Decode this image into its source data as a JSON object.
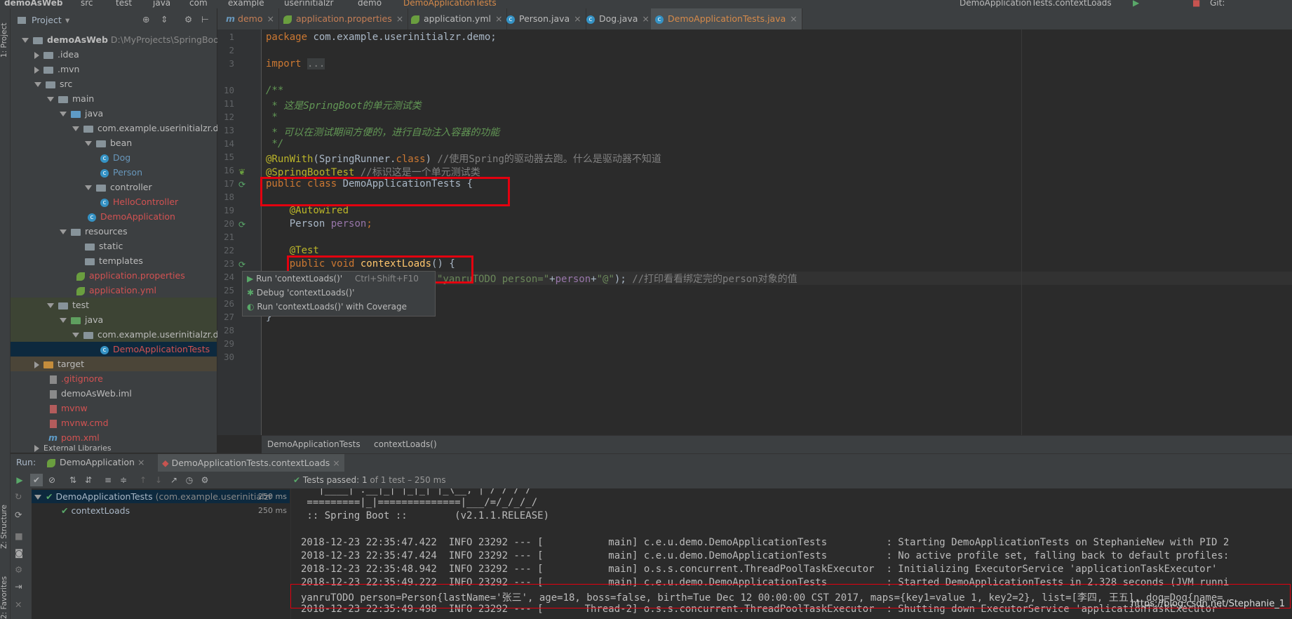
{
  "navbar": {
    "crumbs": [
      "demoAsWeb",
      "src",
      "test",
      "java",
      "com",
      "example",
      "userinitialzr",
      "demo",
      "DemoApplicationTests"
    ],
    "run_config": "DemoApplicationTests.contextLoads",
    "git_label": "Git:"
  },
  "left_stripe": {
    "project_label": "1: Project",
    "structure_label": "Z: Structure",
    "favorites_label": "2: Favorites"
  },
  "project_panel": {
    "title": "Project",
    "tree": [
      {
        "label": "demoAsWeb",
        "extra": "D:\\MyProjects\\SpringBootStu"
      },
      {
        "label": ".idea"
      },
      {
        "label": ".mvn"
      },
      {
        "label": "src"
      },
      {
        "label": "main"
      },
      {
        "label": "java"
      },
      {
        "label": "com.example.userinitialzr.demo"
      },
      {
        "label": "bean"
      },
      {
        "label": "Dog"
      },
      {
        "label": "Person"
      },
      {
        "label": "controller"
      },
      {
        "label": "HelloController"
      },
      {
        "label": "DemoApplication"
      },
      {
        "label": "resources"
      },
      {
        "label": "static"
      },
      {
        "label": "templates"
      },
      {
        "label": "application.properties"
      },
      {
        "label": "application.yml"
      },
      {
        "label": "test"
      },
      {
        "label": "java"
      },
      {
        "label": "com.example.userinitialzr.demo"
      },
      {
        "label": "DemoApplicationTests"
      },
      {
        "label": "target"
      },
      {
        "label": ".gitignore"
      },
      {
        "label": "demoAsWeb.iml"
      },
      {
        "label": "mvnw"
      },
      {
        "label": "mvnw.cmd"
      },
      {
        "label": "pom.xml"
      },
      {
        "label": "External Libraries"
      }
    ]
  },
  "editor_tabs": [
    "demo",
    "application.properties",
    "application.yml",
    "Person.java",
    "Dog.java",
    "DemoApplicationTests.java"
  ],
  "editor": {
    "line_numbers": [
      "1",
      "2",
      "3",
      "10",
      "11",
      "12",
      "13",
      "14",
      "15",
      "16",
      "17",
      "18",
      "19",
      "20",
      "21",
      "22",
      "23",
      "24",
      "25",
      "26",
      "27",
      "28",
      "29",
      "30"
    ],
    "lines": {
      "l1_kw": "package ",
      "l1_rest": "com.example.userinitialzr.demo;",
      "l3_kw": "import ",
      "l3_rest": "...",
      "l10": "/**",
      "l11_a": " * 这是",
      "l11_b": "SpringBoot",
      "l11_c": "的单元测试类",
      "l12": " *",
      "l13": " * 可以在测试期间方便的，进行自动注入容器的功能",
      "l14": " */",
      "l15_an": "@RunWith",
      "l15_a": "(SpringRunner.",
      "l15_kw": "class",
      "l15_b": ") ",
      "l15_cm": "//使用Spring的驱动器去跑。什么是驱动器不知道",
      "l16_an": "@SpringBootTest ",
      "l16_cm": "//标识这是一个单元测试类",
      "l17_kw": "public class ",
      "l17_rest": "DemoApplicationTests {",
      "l19_an": "@Autowired",
      "l20_a": "Person ",
      "l20_b": "person",
      "l20_c": ";",
      "l22_an": "@Test",
      "l23_kw": "public void ",
      "l23_fn": "contextLoads",
      "l23_rest": "() {",
      "l24_str": "\"yanruTODO person=\"",
      "l24_a": "+",
      "l24_b": "person",
      "l24_c": "+",
      "l24_str2": "\"@\"",
      "l24_d": "); ",
      "l24_cm": "//打印看看绑定完的person对象的值",
      "l28": "}"
    },
    "popup": {
      "run": "Run 'contextLoads()'",
      "shortcut": "Ctrl+Shift+F10",
      "debug": "Debug 'contextLoads()'",
      "coverage": "Run 'contextLoads()' with Coverage"
    },
    "breadcrumb": [
      "DemoApplicationTests",
      "contextLoads()"
    ]
  },
  "run_panel": {
    "run_label": "Run:",
    "tabs": [
      "DemoApplication",
      "DemoApplicationTests.contextLoads"
    ],
    "status_prefix": "Tests passed:",
    "status_count": "1",
    "status_suffix": "of 1 test – 250 ms",
    "tree": [
      {
        "label": "DemoApplicationTests",
        "extra": "(com.example.userinitialzr",
        "time": "250 ms"
      },
      {
        "label": "contextLoads",
        "time": "250 ms"
      }
    ],
    "console": [
      "   |____| .__|_| |_|_| |_\\__, | / / / /",
      " =========|_|==============|___/=/_/_/_/",
      " :: Spring Boot ::        (v2.1.1.RELEASE)",
      "",
      "2018-12-23 22:35:47.422  INFO 23292 --- [           main] c.e.u.demo.DemoApplicationTests          : Starting DemoApplicationTests on StephanieNew with PID 2",
      "2018-12-23 22:35:47.424  INFO 23292 --- [           main] c.e.u.demo.DemoApplicationTests          : No active profile set, falling back to default profiles:",
      "2018-12-23 22:35:48.942  INFO 23292 --- [           main] o.s.s.concurrent.ThreadPoolTaskExecutor  : Initializing ExecutorService 'applicationTaskExecutor'",
      "2018-12-23 22:35:49.222  INFO 23292 --- [           main] c.e.u.demo.DemoApplicationTests          : Started DemoApplicationTests in 2.328 seconds (JVM runni",
      "yanruTODO person=Person{lastName='张三', age=18, boss=false, birth=Tue Dec 12 00:00:00 CST 2017, maps={key1=value 1, key2=2}, list=[李四, 王五], dog=Dog{name=",
      "2018-12-23 22:35:49.498  INFO 23292 --- [       Thread-2] o.s.s.concurrent.ThreadPoolTaskExecutor  : Shutting down ExecutorService 'applicationTaskExecutor'"
    ],
    "watermark": "https://blog.csdn.net/Stephanie_1"
  }
}
